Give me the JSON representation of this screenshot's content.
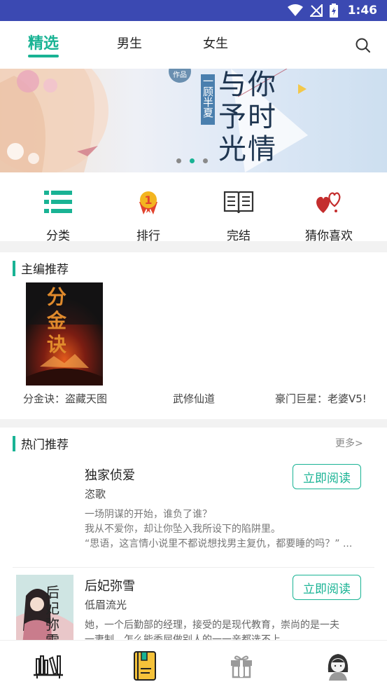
{
  "status": {
    "time": "1:46",
    "icons": [
      "wifi-icon",
      "signal-icon",
      "battery-charging-icon"
    ]
  },
  "nav": {
    "tabs": [
      {
        "label": "精选",
        "active": true
      },
      {
        "label": "男生"
      },
      {
        "label": "女生"
      }
    ],
    "search_icon": "search-icon"
  },
  "banner": {
    "badge": "作品",
    "author_text": "一顾半夏",
    "title_text": "与你予时光情",
    "dots_total": 3,
    "active_dot": 1
  },
  "quick_links": [
    {
      "label": "分类",
      "icon": "list-icon"
    },
    {
      "label": "排行",
      "icon": "medal-icon"
    },
    {
      "label": "完结",
      "icon": "open-book-icon"
    },
    {
      "label": "猜你喜欢",
      "icon": "hearts-icon"
    }
  ],
  "editor_pick": {
    "title": "主编推荐",
    "books": [
      {
        "name": "分金诀：盗藏天图",
        "cover_text": "分金诀"
      },
      {
        "name": "武修仙道"
      },
      {
        "name": "豪门巨星：老婆V5!"
      }
    ]
  },
  "hot": {
    "title": "热门推荐",
    "more": "更多>",
    "books": [
      {
        "title": "独家侦爱",
        "author": "恣歌",
        "desc": [
          "一场阴谋的开始，谁负了谁？",
          "我从不爱你，却让你坠入我所设下的陷阱里。",
          "“思语，这言情小说里不都说想找男主复仇，都要睡的吗？” ..."
        ],
        "button": "立即阅读"
      },
      {
        "title": "后妃弥雪",
        "author": "低眉流光",
        "cover_text": "后妃弥雪",
        "desc": [
          "她，一个后勤部的经理，接受的是现代教育，崇尚的是一夫",
          "一妻制，怎么能委屈做别人的一一亲都选不上"
        ],
        "button": "立即阅读"
      }
    ]
  },
  "bottom_nav": [
    {
      "icon": "bookshelf-icon"
    },
    {
      "icon": "bookstore-icon",
      "active": true
    },
    {
      "icon": "gift-icon"
    },
    {
      "icon": "profile-icon"
    }
  ],
  "colors": {
    "accent": "#19b394",
    "statusbar": "#3b49b2",
    "text": "#222222",
    "muted": "#777777"
  }
}
